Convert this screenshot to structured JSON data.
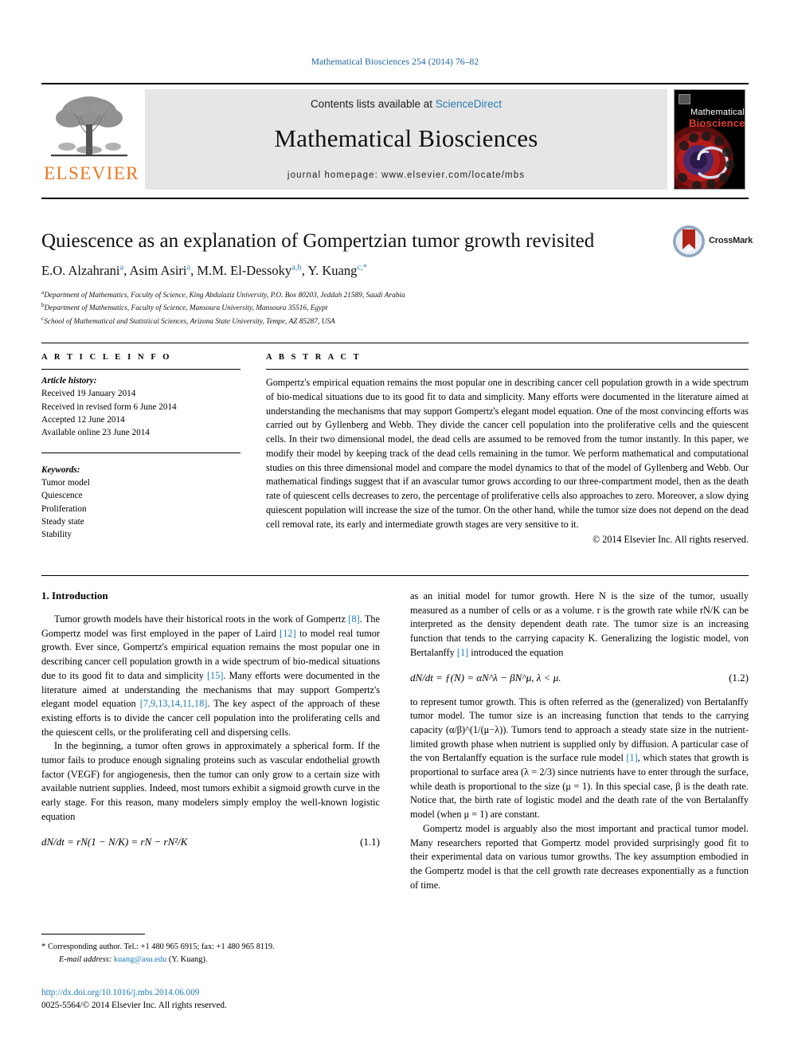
{
  "running_head": "Mathematical Biosciences 254 (2014) 76–82",
  "masthead": {
    "publisher": "ELSEVIER",
    "contents_prefix": "Contents lists available at ",
    "contents_link": "ScienceDirect",
    "journal_title": "Mathematical Biosciences",
    "homepage": "journal homepage: www.elsevier.com/locate/mbs",
    "cover": {
      "line1": "Mathematical",
      "line2": "Biosciences"
    }
  },
  "title": "Quiescence as an explanation of Gompertzian tumor growth revisited",
  "crossmark_label": "CrossMark",
  "authors_html": "E.O. Alzahrani<sup>a</sup>, Asim Asiri<sup>a</sup>, M.M. El-Dessoky<sup>a,b</sup>, Y. Kuang<sup>c,*</sup>",
  "affiliations": [
    "Department of Mathematics, Faculty of Science, King Abdulaziz University, P.O. Box 80203, Jeddah 21589, Saudi Arabia",
    "Department of Mathematics, Faculty of Science, Mansoura University, Mansoura 35516, Egypt",
    "School of Mathematical and Statistical Sciences, Arizona State University, Tempe, AZ 85287, USA"
  ],
  "affiliation_marks": [
    "a",
    "b",
    "c"
  ],
  "article_info": {
    "heading": "A R T I C L E  I N F O",
    "history_label": "Article history:",
    "history": [
      "Received 19 January 2014",
      "Received in revised form 6 June 2014",
      "Accepted 12 June 2014",
      "Available online 23 June 2014"
    ],
    "keywords_label": "Keywords:",
    "keywords": [
      "Tumor model",
      "Quiescence",
      "Proliferation",
      "Steady state",
      "Stability"
    ]
  },
  "abstract": {
    "heading": "A B S T R A C T",
    "text": "Gompertz's empirical equation remains the most popular one in describing cancer cell population growth in a wide spectrum of bio-medical situations due to its good fit to data and simplicity. Many efforts were documented in the literature aimed at understanding the mechanisms that may support Gompertz's elegant model equation. One of the most convincing efforts was carried out by Gyllenberg and Webb. They divide the cancer cell population into the proliferative cells and the quiescent cells. In their two dimensional model, the dead cells are assumed to be removed from the tumor instantly. In this paper, we modify their model by keeping track of the dead cells remaining in the tumor. We perform mathematical and computational studies on this three dimensional model and compare the model dynamics to that of the model of Gyllenberg and Webb. Our mathematical findings suggest that if an avascular tumor grows according to our three-compartment model, then as the death rate of quiescent cells decreases to zero, the percentage of proliferative cells also approaches to zero. Moreover, a slow dying quiescent population will increase the size of the tumor. On the other hand, while the tumor size does not depend on the dead cell removal rate, its early and intermediate growth stages are very sensitive to it.",
    "rights": "© 2014 Elsevier Inc. All rights reserved."
  },
  "section": {
    "heading": "1. Introduction"
  },
  "left_column": {
    "para1_a": "Tumor growth models have their historical roots in the work of Gompertz ",
    "ref8": "[8]",
    "para1_b": ". The Gompertz model was first employed in the paper of Laird ",
    "ref12": "[12]",
    "para1_c": " to model real tumor growth. Ever since, Gompertz's empirical equation remains the most popular one in describing cancer cell population growth in a wide spectrum of bio-medical situations due to its good fit to data and simplicity ",
    "ref15": "[15]",
    "para1_d": ". Many efforts were documented in the literature aimed at understanding the mechanisms that may support Gompertz's elegant model equation ",
    "ref7": "[7,9,13,14,11,18]",
    "para1_e": ". The key aspect of the approach of these existing efforts is to divide the cancer cell population into the proliferating cells and the quiescent cells, or the proliferating cell and dispersing cells.",
    "para2": "In the beginning, a tumor often grows in approximately a spherical form. If the tumor fails to produce enough signaling proteins such as vascular endothelial growth factor (VEGF) for angiogenesis, then the tumor can only grow to a certain size with available nutrient supplies. Indeed, most tumors exhibit a sigmoid growth curve in the early stage. For this reason, many modelers simply employ the well-known logistic equation",
    "equation_1_1": "dN/dt = rN(1 − N/K) = rN − rN²/K",
    "equation_1_1_number": "(1.1)"
  },
  "right_column": {
    "para1_a": "as an initial model for tumor growth. Here N is the size of the tumor, usually measured as a number of cells or as a volume. r is the growth rate while rN/K can be interpreted as the density dependent death rate. The tumor size is an increasing function that tends to the carrying capacity K. Generalizing the logistic model, von Bertalanffy ",
    "ref1": "[1]",
    "para1_b": " introduced the equation",
    "equation_1_2": "dN/dt = ƒ(N) = αN^λ − βN^μ,  λ < μ.",
    "equation_1_2_number": "(1.2)",
    "para2_a": "to represent tumor growth. This is often referred as the (generalized) von Bertalanffy tumor model. The tumor size is an increasing function that tends to the carrying capacity (α/β)^(1/(μ−λ)). Tumors tend to approach a steady state size in the nutrient-limited growth phase when nutrient is supplied only by diffusion. A particular case of the von Bertalanffy equation is the surface rule model ",
    "ref1b": "[1]",
    "para2_b": ", which states that growth is proportional to surface area (λ = 2/3) since nutrients have to enter through the surface, while death is proportional to the size (μ = 1). In this special case, β is the death rate. Notice that, the birth rate of logistic model and the death rate of the von Bertalanffy model (when μ = 1) are constant.",
    "para3": "Gompertz model is arguably also the most important and practical tumor model. Many researchers reported that Gompertz model provided surprisingly good fit to their experimental data on various tumor growths. The key assumption embodied in the Gompertz model is that the cell growth rate decreases exponentially as a function of time."
  },
  "footnote": {
    "star": "*",
    "corresponding": " Corresponding author. Tel.: +1 480 965 6915; fax: +1 480 965 8119.",
    "email_label": "E-mail address:",
    "email": "kuang@asu.edu",
    "email_suffix": " (Y. Kuang)."
  },
  "doi": "http://dx.doi.org/10.1016/j.mbs.2014.06.009",
  "copyright_line": "0025-5564/© 2014 Elsevier Inc. All rights reserved.",
  "colors": {
    "link": "#1c7bb5",
    "elsevier_orange": "#E87722",
    "band_gray": "#e6e6e6",
    "cover_red": "#e23b2e"
  }
}
